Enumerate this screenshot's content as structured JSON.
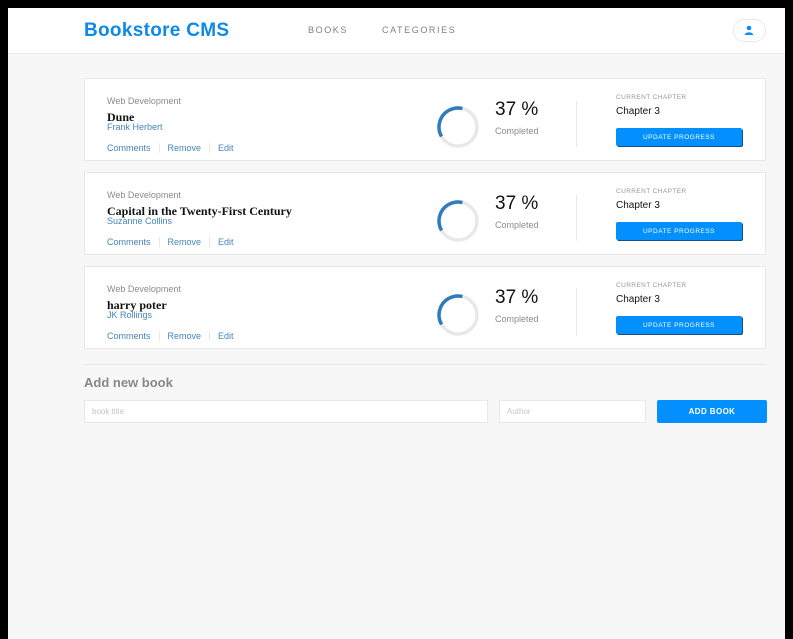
{
  "header": {
    "logo": "Bookstore CMS",
    "nav": [
      {
        "label": "BOOKS"
      },
      {
        "label": "CATEGORIES"
      }
    ],
    "user_icon": "user-icon"
  },
  "books": [
    {
      "genre": "Web Development",
      "title": "Dune",
      "author": "Frank Herbert",
      "actions": {
        "comments": "Comments",
        "remove": "Remove",
        "edit": "Edit"
      },
      "progress_percent": 37,
      "percent_label": "37 %",
      "status": "Completed",
      "chapter_label": "CURRENT CHAPTER",
      "chapter": "Chapter 3",
      "update_button": "UPDATE PROGRESS"
    },
    {
      "genre": "Web Development",
      "title": "Capital in the Twenty-First Century",
      "author": "Suzanne Collins",
      "actions": {
        "comments": "Comments",
        "remove": "Remove",
        "edit": "Edit"
      },
      "progress_percent": 37,
      "percent_label": "37 %",
      "status": "Completed",
      "chapter_label": "CURRENT CHAPTER",
      "chapter": "Chapter 3",
      "update_button": "UPDATE PROGRESS"
    },
    {
      "genre": "Web Development",
      "title": "harry poter",
      "author": "JK Rollings",
      "actions": {
        "comments": "Comments",
        "remove": "Remove",
        "edit": "Edit"
      },
      "progress_percent": 37,
      "percent_label": "37 %",
      "status": "Completed",
      "chapter_label": "CURRENT CHAPTER",
      "chapter": "Chapter 3",
      "update_button": "UPDATE PROGRESS"
    }
  ],
  "add_form": {
    "heading": "Add new book",
    "title_value": "",
    "title_placeholder": "book title",
    "author_value": "",
    "author_placeholder": "Author",
    "submit": "ADD BOOK"
  },
  "colors": {
    "accent": "#0290ff",
    "logo": "#0d8ae8",
    "link": "#4386bf",
    "ring_progress": "#307bbe",
    "ring_track": "#e8e8e8",
    "background": "#f7f7f7"
  }
}
